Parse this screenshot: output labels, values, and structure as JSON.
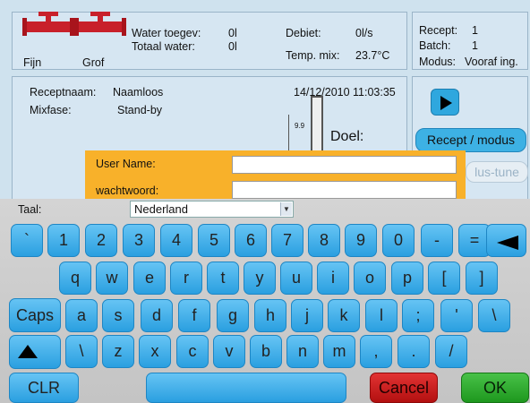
{
  "status": {
    "valve1_label": "Fijn",
    "valve2_label": "Grof",
    "water_toegev_label": "Water toegev:",
    "water_toegev_value": "0l",
    "totaal_water_label": "Totaal water:",
    "totaal_water_value": "0l",
    "debiet_label": "Debiet:",
    "debiet_value": "0l/s",
    "temp_label": "Temp. mix:",
    "temp_value": "23.7°C"
  },
  "info": {
    "recept_label": "Recept:",
    "recept_value": "1",
    "batch_label": "Batch:",
    "batch_value": "1",
    "modus_label": "Modus:",
    "modus_value": "Vooraf ing."
  },
  "recipe": {
    "naam_label": "Receptnaam:",
    "naam_value": "Naamloos",
    "mixfase_label": "Mixfase:",
    "mixfase_value": "Stand-by",
    "datetime": "14/12/2010 11:03:35",
    "gauge_top": "9.9",
    "doel_label": "Doel:"
  },
  "side_buttons": {
    "recipe_mode": "Recept / modus",
    "lus_tune": "lus-tune"
  },
  "login": {
    "username_label": "User Name:",
    "username_value": "",
    "password_label": "wachtwoord:",
    "password_value": ""
  },
  "language": {
    "label": "Taal:",
    "selected": "Nederland"
  },
  "keyboard": {
    "row1": [
      "`",
      "1",
      "2",
      "3",
      "4",
      "5",
      "6",
      "7",
      "8",
      "9",
      "0",
      "-",
      "="
    ],
    "row2": [
      "q",
      "w",
      "e",
      "r",
      "t",
      "y",
      "u",
      "i",
      "o",
      "p",
      "[",
      "]"
    ],
    "caps": "Caps",
    "row3": [
      "a",
      "s",
      "d",
      "f",
      "g",
      "h",
      "j",
      "k",
      "l",
      ";",
      "'",
      "\\"
    ],
    "row4": [
      "\\",
      "z",
      "x",
      "c",
      "v",
      "b",
      "n",
      "m",
      ",",
      ".",
      "/"
    ],
    "clr": "CLR",
    "cancel": "Cancel",
    "ok": "OK"
  },
  "colors": {
    "key": "#2a9fe0",
    "cancel": "#c41818",
    "ok": "#23a023",
    "login_panel": "#f8b12a",
    "valve": "#c8202a"
  }
}
